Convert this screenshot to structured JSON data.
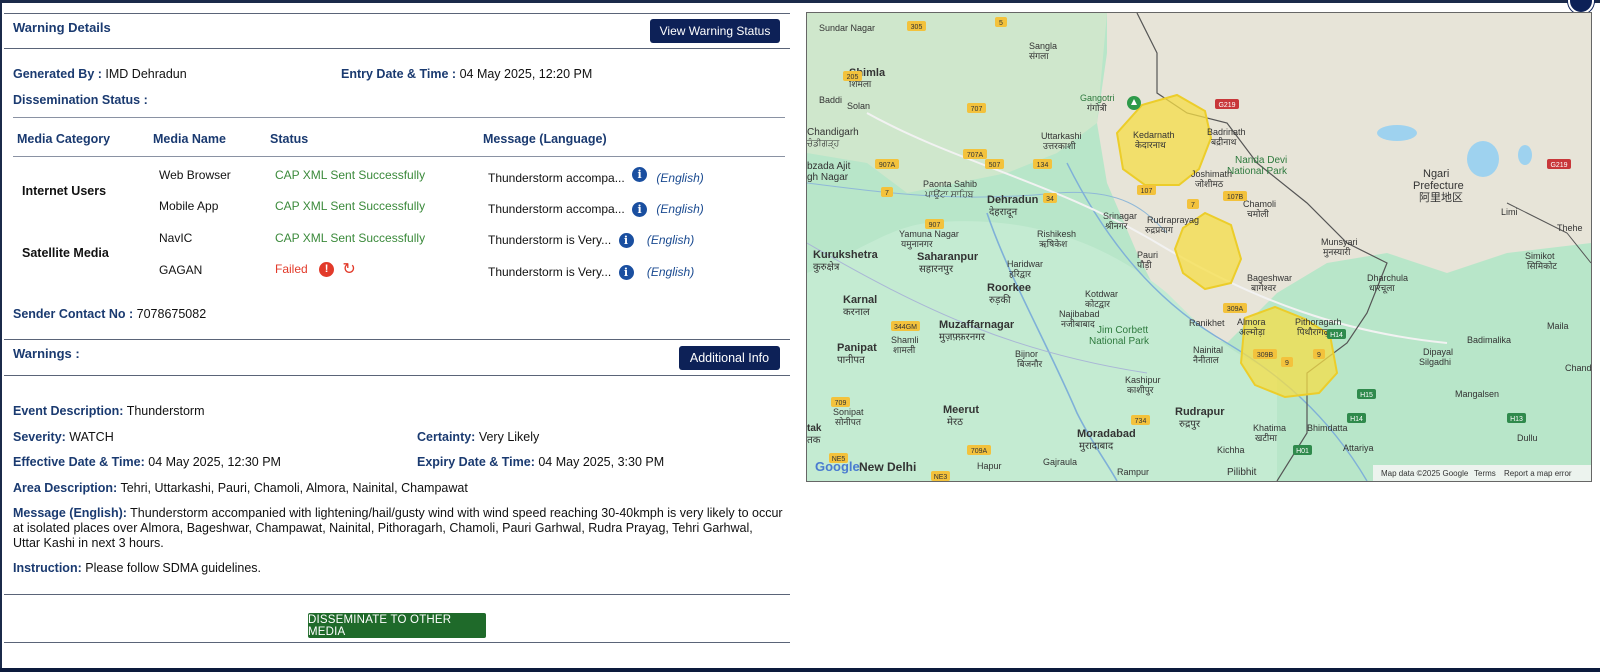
{
  "warning_details": {
    "title": "Warning Details",
    "view_status_button": "View Warning Status",
    "generated_by_label": "Generated By :",
    "generated_by_value": "IMD Dehradun",
    "entry_date_label": "Entry Date & Time :",
    "entry_date_value": "04 May 2025, 12:20 PM",
    "dissemination_label": "Dissemination Status :"
  },
  "media_table": {
    "headers": [
      "Media Category",
      "Media Name",
      "Status",
      "Message (Language)"
    ],
    "categories": [
      "Internet Users",
      "Satellite Media"
    ],
    "rows": [
      {
        "name": "Web Browser",
        "status": "CAP XML Sent Successfully",
        "message": "Thunderstorm accompa...",
        "language": "(English)"
      },
      {
        "name": "Mobile App",
        "status": "CAP XML Sent Successfully",
        "message": "Thunderstorm accompa...",
        "language": "(English)"
      },
      {
        "name": "NavIC",
        "status": "CAP XML Sent Successfully",
        "message": "Thunderstorm is Very...",
        "language": "(English)"
      },
      {
        "name": "GAGAN",
        "status": "Failed",
        "message": "Thunderstorm is Very...",
        "language": "(English)"
      }
    ]
  },
  "sender": {
    "label": "Sender Contact No :",
    "value": "7078675082"
  },
  "warnings": {
    "title": "Warnings :",
    "additional_info_button": "Additional Info",
    "event_label": "Event Description:",
    "event_value": "Thunderstorm",
    "severity_label": "Severity:",
    "severity_value": "WATCH",
    "certainty_label": "Certainty:",
    "certainty_value": "Very Likely",
    "effective_label": "Effective Date & Time:",
    "effective_value": "04 May 2025, 12:30 PM",
    "expiry_label": "Expiry Date & Time:",
    "expiry_value": "04 May 2025, 3:30 PM",
    "area_label": "Area Description:",
    "area_value": "Tehri, Uttarkashi, Pauri, Chamoli, Almora, Nainital, Champawat",
    "message_label": "Message (English):",
    "message_value": "Thunderstorm accompanied with lightening/hail/gusty wind with wind speed reaching 30-40kmph is very likely to occur at isolated places over Almora, Bageshwar, Champawat, Nainital, Pithoragarh, Chamoli, Pauri Garhwal, Rudra Prayag, Tehri Garhwal, Uttar Kashi in next 3 hours.",
    "instruction_label": "Instruction:",
    "instruction_value": "Please follow SDMA guidelines."
  },
  "disseminate_button": "DISSEMINATE TO OTHER MEDIA",
  "map": {
    "labels": {
      "sundar_nagar": "Sundar Nagar",
      "shimla": "Shimla",
      "shimla_hi": "शिमला",
      "baddi": "Baddi",
      "solan": "Solan",
      "chandigarh": "Chandigarh",
      "chandigarh_pa": "ਚੰਡੀਗੜ੍ਹ",
      "ajit": "bzada Ajit",
      "ajit2": "gh Nagar",
      "sangla": "Sangla",
      "sangla_hi": "संगला",
      "gangotri": "Gangotri",
      "gangotri_hi": "गंगोत्री",
      "uttarkashi": "Uttarkashi",
      "uttarkashi_hi": "उत्तरकाशी",
      "kedarnath": "Kedarnath",
      "kedarnath_hi": "केदारनाथ",
      "badrinath": "Badrinath",
      "badrinath_hi": "बद्रीनाथ",
      "nanda_devi": "Nanda Devi",
      "nanda_devi2": "National Park",
      "joshimath": "Joshimath",
      "joshimath_hi": "जोशीमठ",
      "ngari": "Ngari",
      "ngari2": "Prefecture",
      "ngari_cn": "阿里地区",
      "chamoli": "Chamoli",
      "chamoli_hi": "चमोली",
      "paonta": "Paonta Sahib",
      "paonta_hi": "ਪਾਉਂਟਾ ਸਾਹਿਬ",
      "dehradun": "Dehradun",
      "dehradun_hi": "देहरादून",
      "srinagar": "Srinagar",
      "srinagar_hi": "श्रीनगर",
      "rudraprayag": "Rudraprayag",
      "rudraprayag_hi": "रुद्रप्रयाग",
      "yamuna": "Yamuna Nagar",
      "yamuna_hi": "यमुनानगर",
      "rishikesh": "Rishikesh",
      "rishikesh_hi": "ऋषिकेश",
      "kurukshetra": "Kurukshetra",
      "kurukshetra_hi": "कुरुक्षेत्र",
      "saharanpur": "Saharanpur",
      "saharanpur_hi": "सहारनपुर",
      "haridwar": "Haridwar",
      "haridwar_hi": "हरिद्वार",
      "pauri": "Pauri",
      "pauri_hi": "पौड़ी",
      "munsyari": "Munsyari",
      "munsyari_hi": "मुनस्यारी",
      "bageshwar": "Bageshwar",
      "bageshwar_hi": "बागेश्वर",
      "dharchula": "Dharchula",
      "dharchula_hi": "धारचूला",
      "simikot": "Simikot",
      "simikot_ne": "सिमिकोट",
      "karnal": "Karnal",
      "karnal_hi": "करनाल",
      "roorkee": "Roorkee",
      "roorkee_hi": "रुड़की",
      "kotdwar": "Kotdwar",
      "kotdwar_hi": "कोटद्वार",
      "najibabad": "Najibabad",
      "najibabad_hi": "नजीबाबाद",
      "muzaffarnagar": "Muzaffarnagar",
      "muzaffarnagar_hi": "मुज़फ़्फ़रनगर",
      "jim_corbett": "Jim Corbett",
      "jim_corbett2": "National Park",
      "ranikhet": "Ranikhet",
      "almora": "Almora",
      "almora_hi": "अल्मोड़ा",
      "pithoragarh": "Pithoragarh",
      "pithoragarh_hi": "पिथौरागढ़",
      "nainital": "Nainital",
      "nainital_hi": "नैनीताल",
      "panipat": "Panipat",
      "panipat_hi": "पानीपत",
      "shamli": "Shamli",
      "shamli_hi": "शामली",
      "bijnor": "Bijnor",
      "bijnor_hi": "बिजनौर",
      "kashipur": "Kashipur",
      "kashipur_hi": "काशीपुर",
      "dipayal": "Dipayal",
      "dipayal2": "Silgadhi",
      "badimalika": "Badimalika",
      "mangalsen": "Mangalsen",
      "sonipat": "Sonipat",
      "sonipat_hi": "सोनीपत",
      "meerut": "Meerut",
      "meerut_hi": "मेरठ",
      "moradabad": "Moradabad",
      "moradabad_hi": "मुरादाबाद",
      "rudrapur": "Rudrapur",
      "rudrapur_hi": "रुद्रपुर",
      "khatima": "Khatima",
      "khatima_hi": "खटीमा",
      "bhimdatta": "Bhimdatta",
      "attariya": "Attariya",
      "new_delhi": "New Delhi",
      "hapur": "Hapur",
      "gajraula": "Gajraula",
      "rampur": "Rampur",
      "pilibhit": "Pilibhit",
      "kichha": "Kichha",
      "dullu": "Dullu",
      "maila": "Maila",
      "chanda": "Chanda",
      "thehe": "Thehe",
      "lim": "Limi",
      "tak": "tak",
      "tak_hi": "तक"
    },
    "footer": {
      "google": "Google",
      "map_data": "Map data ©2025 Google",
      "terms": "Terms",
      "report": "Report a map error"
    },
    "road_numbers": [
      "305",
      "5",
      "205",
      "707",
      "907A",
      "707A",
      "507",
      "134",
      "7",
      "907",
      "34",
      "107",
      "107B",
      "7",
      "9",
      "309A",
      "9",
      "309B",
      "H14",
      "H15",
      "H13",
      "H14",
      "H01",
      "734",
      "709A",
      "709",
      "NE5",
      "NE3",
      "344GM",
      "G219",
      "G219"
    ]
  }
}
